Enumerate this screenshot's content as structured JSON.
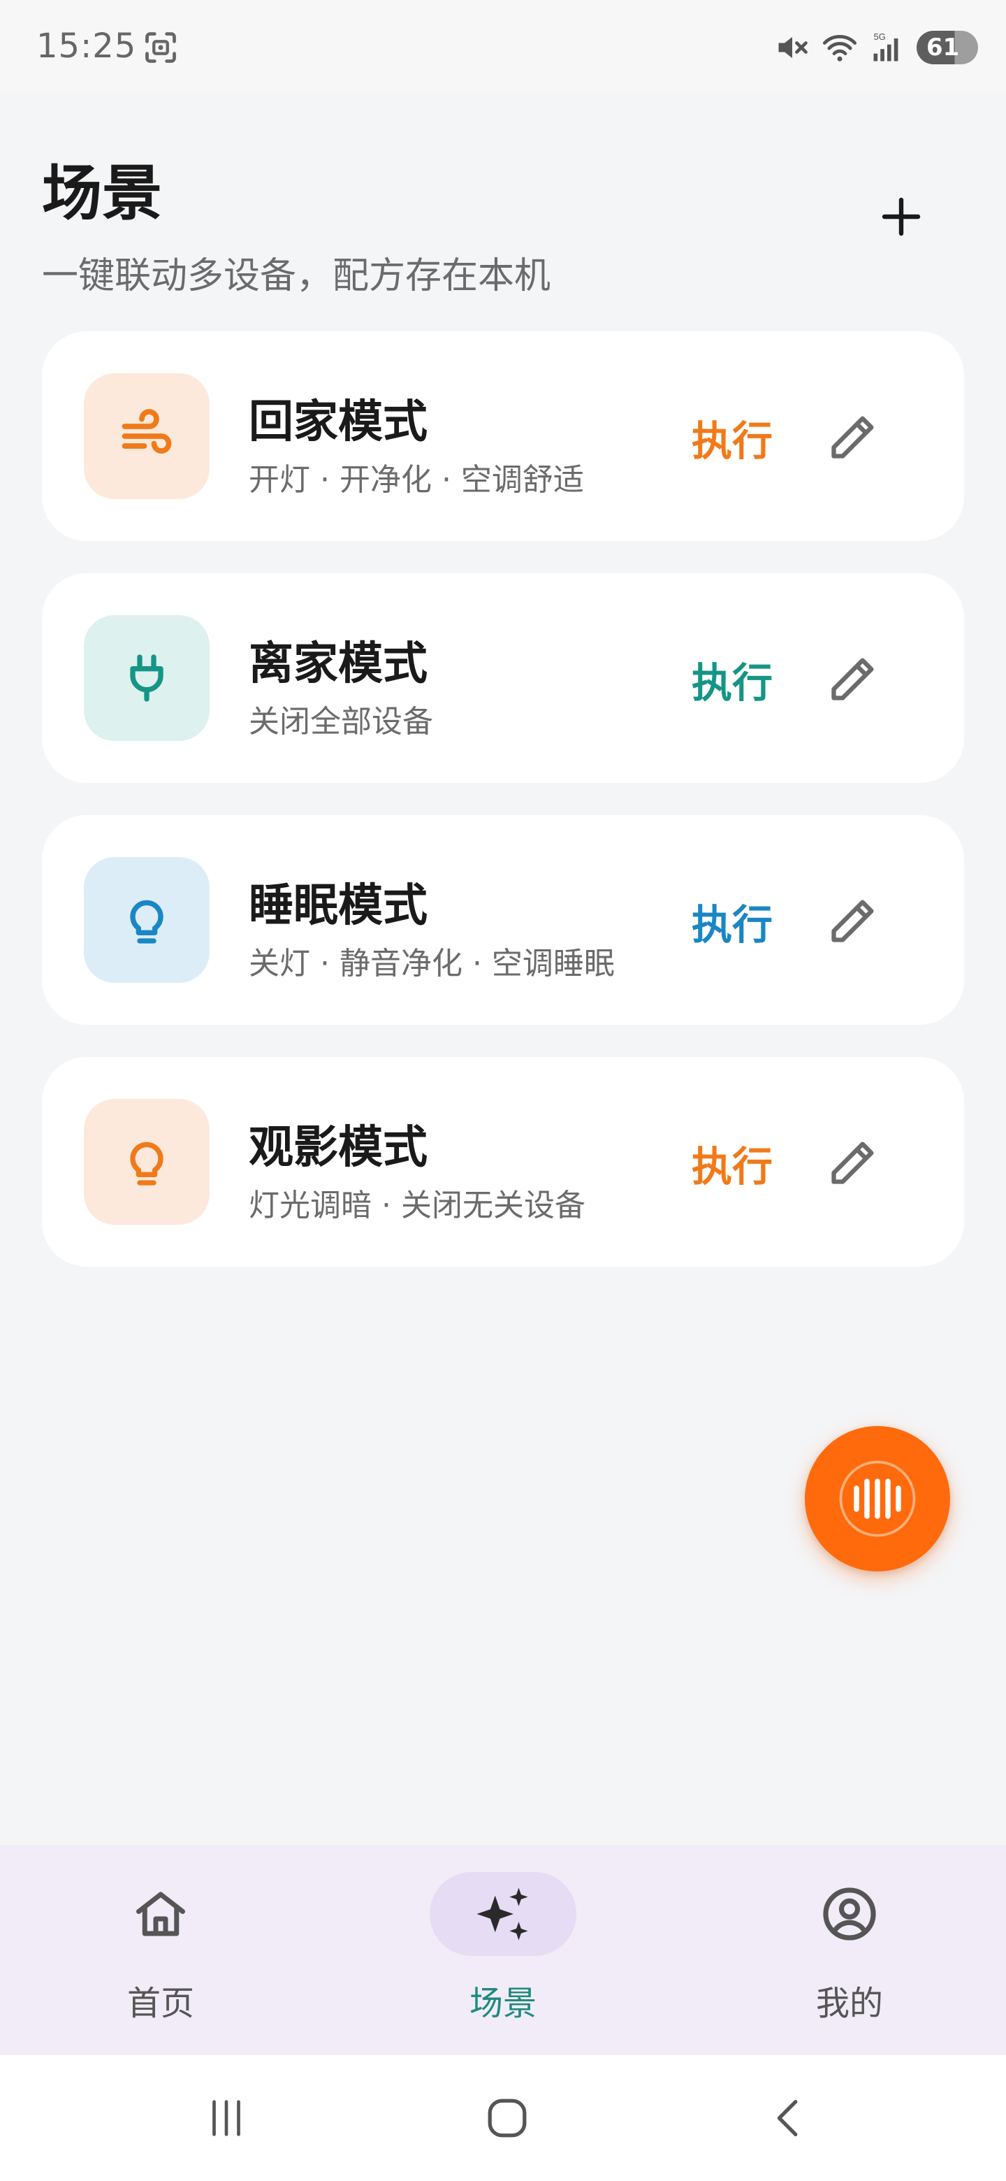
{
  "status_bar": {
    "time": "15:25",
    "battery": "61",
    "icons": [
      "screenshot-icon",
      "mute-icon",
      "wifi-icon",
      "signal-5g-icon",
      "battery-icon"
    ]
  },
  "header": {
    "title": "场景",
    "subtitle": "一键联动多设备，配方存在本机",
    "add_icon": "plus-icon"
  },
  "scenes": [
    {
      "name": "回家模式",
      "desc": "开灯 · 开净化 · 空调舒适",
      "run": "执行",
      "icon": "wind-icon",
      "accent": "#F07A1A",
      "icon_bg": "#FDE9DC"
    },
    {
      "name": "离家模式",
      "desc": "关闭全部设备",
      "run": "执行",
      "icon": "plug-icon",
      "accent": "#159586",
      "icon_bg": "#DDF1EE"
    },
    {
      "name": "睡眠模式",
      "desc": "关灯 · 静音净化 · 空调睡眠",
      "run": "执行",
      "icon": "bulb-icon",
      "accent": "#1A86C4",
      "icon_bg": "#DCEDF8"
    },
    {
      "name": "观影模式",
      "desc": "灯光调暗 · 关闭无关设备",
      "run": "执行",
      "icon": "bulb-icon",
      "accent": "#F07A1A",
      "icon_bg": "#FDE9DC"
    }
  ],
  "fab": {
    "icon": "voice-wave-icon",
    "color": "#FF6A0D"
  },
  "bottom_nav": [
    {
      "label": "首页",
      "icon": "home-icon",
      "active": false
    },
    {
      "label": "场景",
      "icon": "sparkle-icon",
      "active": true
    },
    {
      "label": "我的",
      "icon": "user-circle-icon",
      "active": false
    }
  ],
  "system_nav": [
    "recents-icon",
    "home-circle-icon",
    "back-icon"
  ]
}
